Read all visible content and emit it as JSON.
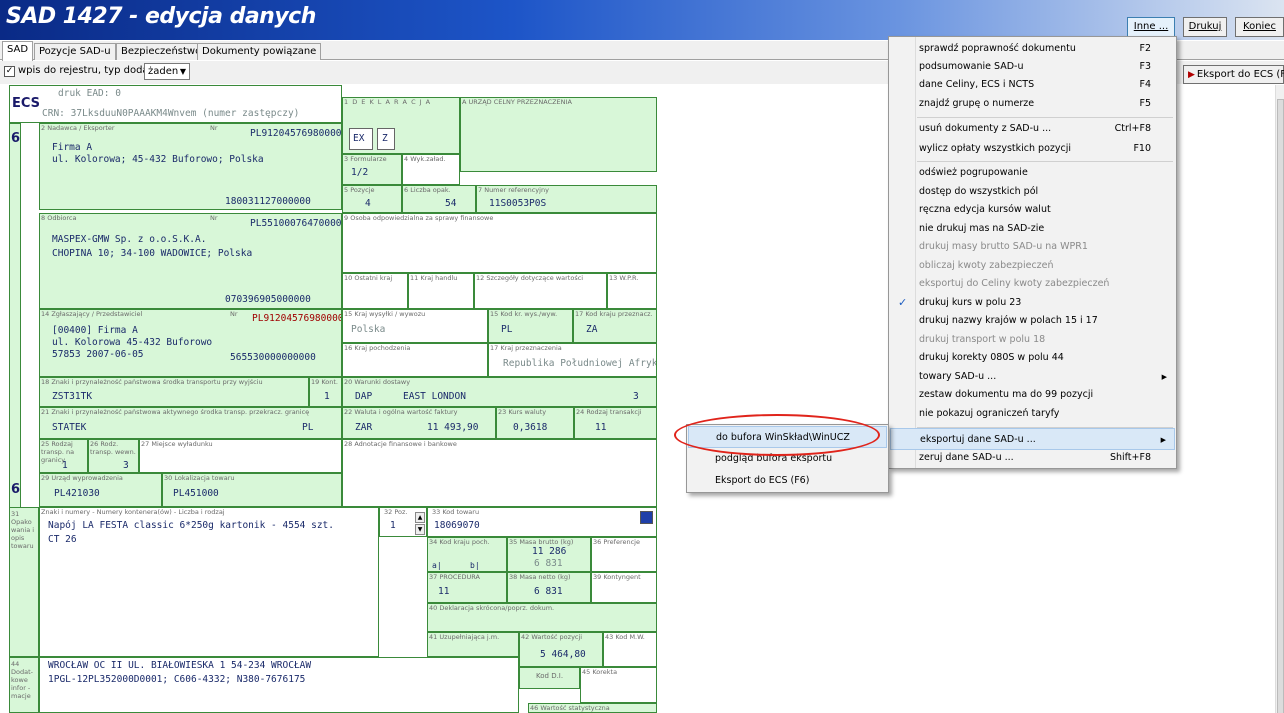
{
  "window": {
    "title": "SAD 1427 - edycja danych"
  },
  "title_buttons": {
    "inne": "Inne ...",
    "drukuj": "Drukuj",
    "koniec": "Koniec"
  },
  "tabs": [
    {
      "label": "SAD"
    },
    {
      "label": "Pozycje SAD-u"
    },
    {
      "label": "Bezpieczeństwo"
    },
    {
      "label": "Dokumenty powiązane"
    }
  ],
  "toolbar": {
    "checkbox_label": "wpis do rejestru, typ dodatk.",
    "checked": true,
    "select_value": "żaden",
    "ecs_button": "Eksport do ECS (F6)"
  },
  "form": {
    "ecs": "ECS",
    "druk": "druk EAD: 0",
    "crn": "CRN: 37LksduuN0PAAAKM4Wnvem (numer zastępczy)",
    "big_6a": "6",
    "big_6b": "6",
    "f1_label": "1  D E K L A R A C J A",
    "f1_ex": "EX",
    "f1_z": "Z",
    "fA_label": "A URZĄD CELNY PRZEZNACZENIA",
    "f2_label": "2 Nadawca / Eksporter",
    "f2_nr": "Nr",
    "f2_nip": "PL9120457698000000",
    "f2_name": "Firma A",
    "f2_addr": "ul. Kolorowa; 45-432 Buforowo; Polska",
    "f2_regon": "180031127000000",
    "f3_label": "3 Formularze",
    "f3_val": "1/2",
    "f4_label": "4 Wyk.załad.",
    "f5_label": "5 Pozycje",
    "f5_val": "4",
    "f6_label": "6 Liczba opak.",
    "f6_val": "54",
    "f7_label": "7 Numer referencyjny",
    "f7_val": "11S0053P0S",
    "f8_label": "8 Odbiorca",
    "f8_nr": "Nr",
    "f8_nip": "PL5510007647000000",
    "f8_name": "MASPEX-GMW Sp. z o.o.S.K.A.",
    "f8_addr": "CHOPINA 10; 34-100 WADOWICE; Polska",
    "f8_regon": "070396905000000",
    "f9_label": "9 Osoba odpowiedzialna za sprawy finansowe",
    "f10_label": "10 Ostatni kraj",
    "f11_label": "11 Kraj handlu",
    "f12_label": "12 Szczegóły dotyczące wartości",
    "f13_label": "13 W.P.R.",
    "f14_label": "14 Zgłaszający / Przedstawiciel",
    "f14_nr": "Nr",
    "f14_nip": "PL9120457698000000",
    "f14_code": "[00400] Firma A",
    "f14_addr": "ul. Kolorowa 45-432 Buforowo",
    "f14_date": "57853 2007-06-05",
    "f14_regon": "565530000000000",
    "f15_label": "15 Kraj wysyłki / wywozu",
    "f15_val": "Polska",
    "f15a_label": "15 Kod kr. wys./wyw.",
    "f15a_val": "PL",
    "f17a_label": "17 Kod kraju przeznacz.",
    "f17a_val": "ZA",
    "f16_label": "16 Kraj pochodzenia",
    "f17_label": "17 Kraj przeznaczenia",
    "f17_val": "Republika Południowej Afryki",
    "f18_label": "18 Znaki i przynależność państwowa środka transportu przy wyjściu",
    "f18_val": "ZST31TK",
    "f19_label": "19 Kont.",
    "f19_val": "1",
    "f20_label": "20 Warunki dostawy",
    "f20_code": "DAP",
    "f20_place": "EAST LONDON",
    "f20_n": "3",
    "f21_label": "21 Znaki i przynależność państwowa aktywnego środka transp. przekracz. granicę",
    "f21_val": "STATEK",
    "f21_pl": "PL",
    "f22_label": "22 Waluta i ogólna wartość faktury",
    "f22_cur": "ZAR",
    "f22_amt": "11 493,90",
    "f23_label": "23 Kurs waluty",
    "f23_val": "0,3618",
    "f24_label": "24 Rodzaj transakcji",
    "f24_val": "11",
    "f25_label": "25 Rodzaj transp. na granicy",
    "f25_val": "1",
    "f26_label": "26 Rodz. transp. wewn.",
    "f26_val": "3",
    "f27_label": "27 Miejsce wyładunku",
    "f28_label": "28 Adnotacje finansowe i bankowe",
    "f29_label": "29 Urząd wyprowadzenia",
    "f29_val": "PL421030",
    "f30_label": "30 Lokalizacja towaru",
    "f30_val": "PL451000",
    "f31_label": "31 Opako wania i opis towaru",
    "f31_hdr": "Znaki i numery - Numery kontenera(ów) - Liczba i rodzaj",
    "f31_desc": "Napój LA FESTA classic 6*250g kartonik - 4554 szt.",
    "f31_ct": "CT 26",
    "f32_label": "32 Poz.",
    "f32_val": "1",
    "f33_label": "33 Kod towaru",
    "f33_val": "18069070",
    "f34_label": "34 Kod kraju poch.",
    "f34_a": "a|",
    "f34_b": "b|",
    "f35_label": "35 Masa brutto (kg)",
    "f35_a": "11 286",
    "f35_b": "6 831",
    "f36_label": "36 Preferencje",
    "f37_label": "37 PROCEDURA",
    "f37_val": "11",
    "f38_label": "38 Masa netto (kg)",
    "f38_val": "6 831",
    "f39_label": "39 Kontyngent",
    "f40_label": "40 Deklaracja skrócona/poprz. dokum.",
    "f41_label": "41 Uzupełniająca j.m.",
    "f42_label": "42 Wartość pozycji",
    "f42_val": "5 464,80",
    "f43_label": "43 Kod M.W.",
    "f44_label": "44 Dodat- kowe infor - macje",
    "f44_line1": "WROCŁAW OC II UL. BIAŁOWIESKA 1 54-234 WROCŁAW",
    "f44_line2": "1PGL-12PL352000D0001; C606-4332; N380-7676175",
    "kod_di": "Kod D.I.",
    "f45_label": "45 Korekta",
    "f46_label": "46 Wartość statystyczna"
  },
  "menu": {
    "items": [
      {
        "label": "sprawdź poprawność dokumentu",
        "shortcut": "F2",
        "disabled": false
      },
      {
        "label": "podsumowanie SAD-u",
        "shortcut": "F3",
        "disabled": false
      },
      {
        "label": "dane Celiny, ECS i NCTS",
        "shortcut": "F4",
        "disabled": false
      },
      {
        "label": "znajdź grupę o numerze",
        "shortcut": "F5",
        "disabled": false
      },
      {
        "label": "usuń dokumenty z SAD-u ...",
        "shortcut": "Ctrl+F8",
        "disabled": false
      },
      {
        "label": "wylicz opłaty wszystkich pozycji",
        "shortcut": "F10",
        "disabled": false
      },
      {
        "label": "odśwież pogrupowanie",
        "shortcut": "",
        "disabled": false
      },
      {
        "label": "dostęp do wszystkich pól",
        "shortcut": "",
        "disabled": false
      },
      {
        "label": "ręczna edycja kursów walut",
        "shortcut": "",
        "disabled": false
      },
      {
        "label": "nie drukuj mas na SAD-zie",
        "shortcut": "",
        "disabled": false
      },
      {
        "label": "drukuj masy brutto SAD-u na WPR1",
        "shortcut": "",
        "disabled": true
      },
      {
        "label": "obliczaj kwoty zabezpieczeń",
        "shortcut": "",
        "disabled": true
      },
      {
        "label": "eksportuj do Celiny kwoty zabezpieczeń",
        "shortcut": "",
        "disabled": true
      },
      {
        "label": "drukuj kurs w polu 23",
        "shortcut": "",
        "disabled": false,
        "checked": true
      },
      {
        "label": "drukuj nazwy krajów w polach 15 i 17",
        "shortcut": "",
        "disabled": false
      },
      {
        "label": "drukuj transport w polu 18",
        "shortcut": "",
        "disabled": true
      },
      {
        "label": "drukuj korekty 080S w polu 44",
        "shortcut": "",
        "disabled": false
      },
      {
        "label": "towary SAD-u ...",
        "shortcut": "",
        "disabled": false,
        "submenu": true
      },
      {
        "label": "zestaw dokumentu ma do 99 pozycji",
        "shortcut": "",
        "disabled": false
      },
      {
        "label": "nie pokazuj ograniczeń taryfy",
        "shortcut": "",
        "disabled": false
      },
      {
        "label": "eksportuj dane SAD-u ...",
        "shortcut": "",
        "disabled": false,
        "submenu": true,
        "highlighted": true
      },
      {
        "label": "zeruj dane SAD-u ...",
        "shortcut": "Shift+F8",
        "disabled": false
      }
    ],
    "submenu_items": [
      {
        "label": "do bufora WinSkład\\WinUCZ",
        "highlighted": true
      },
      {
        "label": "podgląd bufora eksportu"
      },
      {
        "label": "Eksport do ECS (F6)"
      }
    ]
  },
  "colors": {
    "form_green": "#d8f7d8",
    "form_border": "#3a8a3a",
    "title_blue": "#0a2a86",
    "annotation_red": "#e0241b"
  }
}
